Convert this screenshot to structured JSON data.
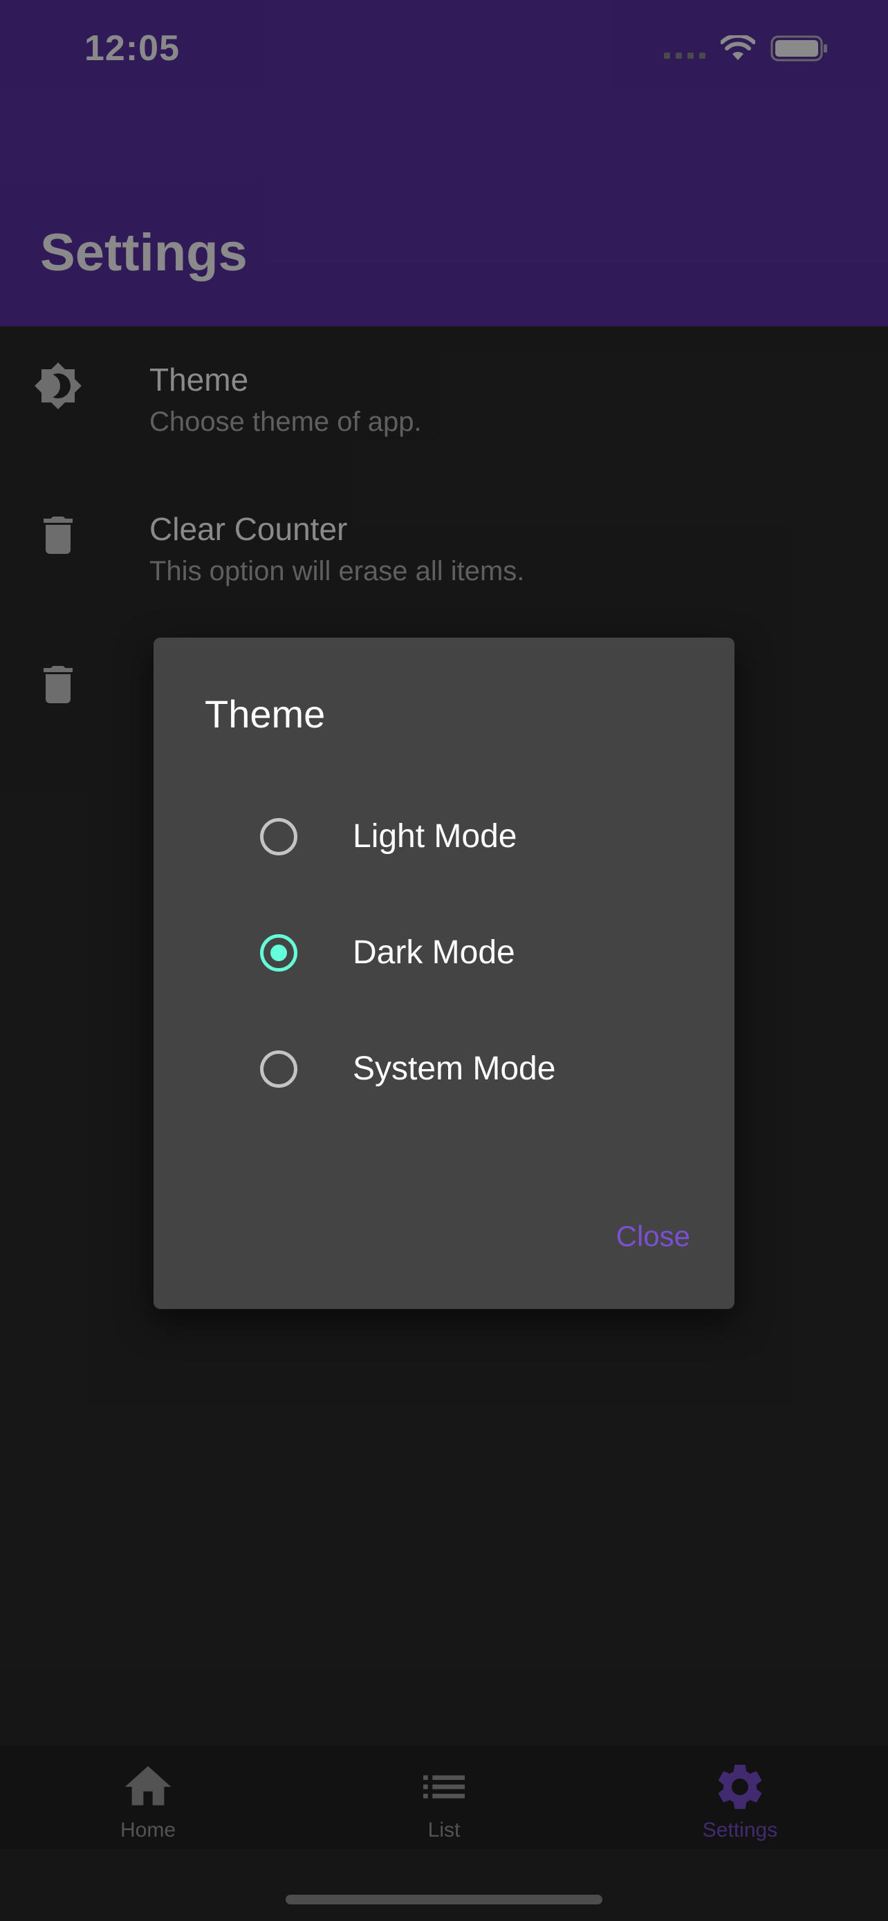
{
  "status_bar": {
    "time": "12:05",
    "icons": [
      "cellular-icon",
      "wifi-icon",
      "battery-icon"
    ]
  },
  "app_bar": {
    "title": "Settings",
    "color": "#5a32a3"
  },
  "settings": {
    "items": [
      {
        "title": "Theme",
        "subtitle": "Choose theme of app.",
        "icon": "brightness-icon"
      },
      {
        "title": "Clear Counter",
        "subtitle": "This option will erase all items.",
        "icon": "trash-icon"
      },
      {
        "title": "",
        "subtitle": "",
        "icon": "trash-icon"
      }
    ]
  },
  "dialog": {
    "title": "Theme",
    "options": [
      {
        "label": "Light Mode",
        "selected": false
      },
      {
        "label": "Dark Mode",
        "selected": true
      },
      {
        "label": "System Mode",
        "selected": false
      }
    ],
    "close_label": "Close",
    "accent_color": "#64ffda",
    "action_color": "#7b4fd0"
  },
  "bottom_nav": {
    "items": [
      {
        "label": "Home",
        "icon": "home-icon",
        "active": false
      },
      {
        "label": "List",
        "icon": "list-icon",
        "active": false
      },
      {
        "label": "Settings",
        "icon": "gear-icon",
        "active": true
      }
    ]
  }
}
